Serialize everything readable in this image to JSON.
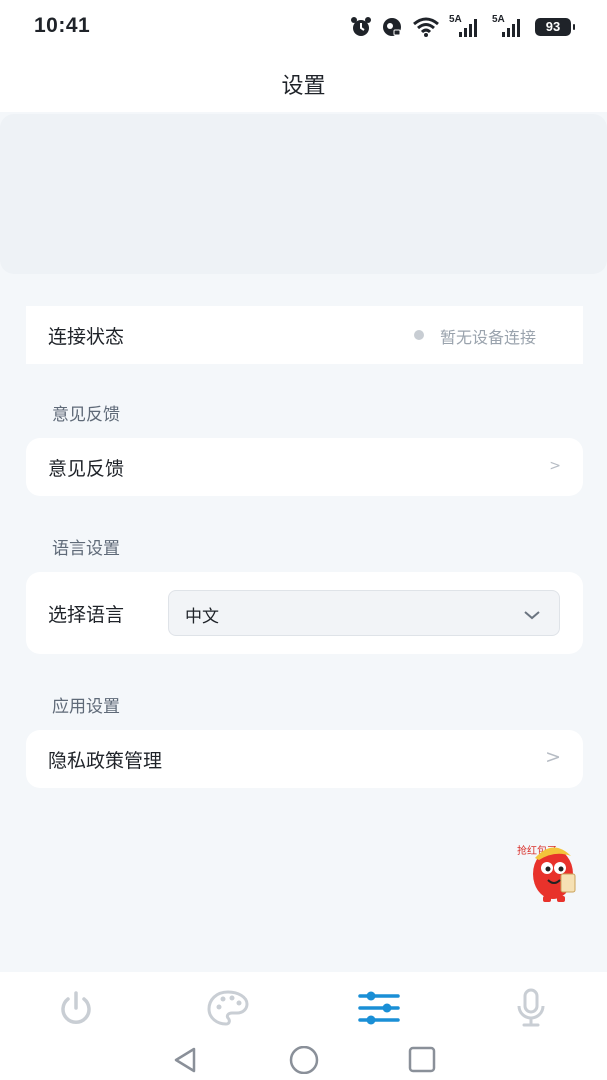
{
  "status_bar": {
    "time": "10:41",
    "icons": [
      "alarm-icon",
      "notification-icon",
      "wifi-icon",
      "signal-5a-icon",
      "signal-5a-icon",
      "battery-icon"
    ],
    "signal_label": "5A",
    "battery": "93"
  },
  "header": {
    "title": "设置"
  },
  "connection": {
    "label": "连接状态",
    "status": "暂无设备连接"
  },
  "feedback_section": {
    "title": "意见反馈",
    "item_label": "意见反馈",
    "chevron": ">"
  },
  "language_section": {
    "title": "语言设置",
    "item_label": "选择语言",
    "selected": "中文"
  },
  "app_section": {
    "title": "应用设置",
    "item_label": "隐私政策管理",
    "chevron": ">"
  },
  "mascot": {
    "icon": "red-envelope-mascot-icon",
    "text": "抢红包了"
  },
  "tab_bar": {
    "active_index": 2,
    "active_color": "#1a8fd6",
    "inactive_color": "#c9ced4",
    "tabs": [
      {
        "icon": "power-icon"
      },
      {
        "icon": "palette-icon"
      },
      {
        "icon": "sliders-icon"
      },
      {
        "icon": "microphone-icon"
      }
    ]
  },
  "system_nav": {
    "buttons": [
      "back-icon",
      "home-icon",
      "recents-icon"
    ]
  }
}
